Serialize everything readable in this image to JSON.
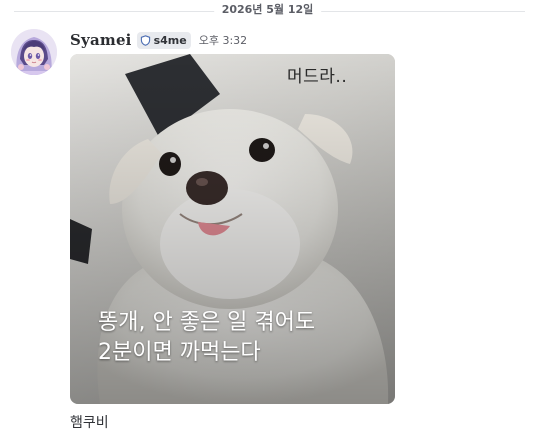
{
  "divider": {
    "date": "2026년 5월 12일"
  },
  "message": {
    "username": "Syamei",
    "tag": "s4me",
    "timestamp": "오후 3:32",
    "image": {
      "top_caption": "머드라..",
      "caption_line1": "똥개, 안 좋은 일 겪어도",
      "caption_line2": "2분이면 까먹는다"
    },
    "text": "햄쿠비"
  },
  "icons": {
    "tag": "shield-icon",
    "avatar": "anime-avatar"
  },
  "colors": {
    "username": "#2b2d31",
    "tag_bg": "#e8eaee",
    "timestamp": "#5c5e66"
  }
}
